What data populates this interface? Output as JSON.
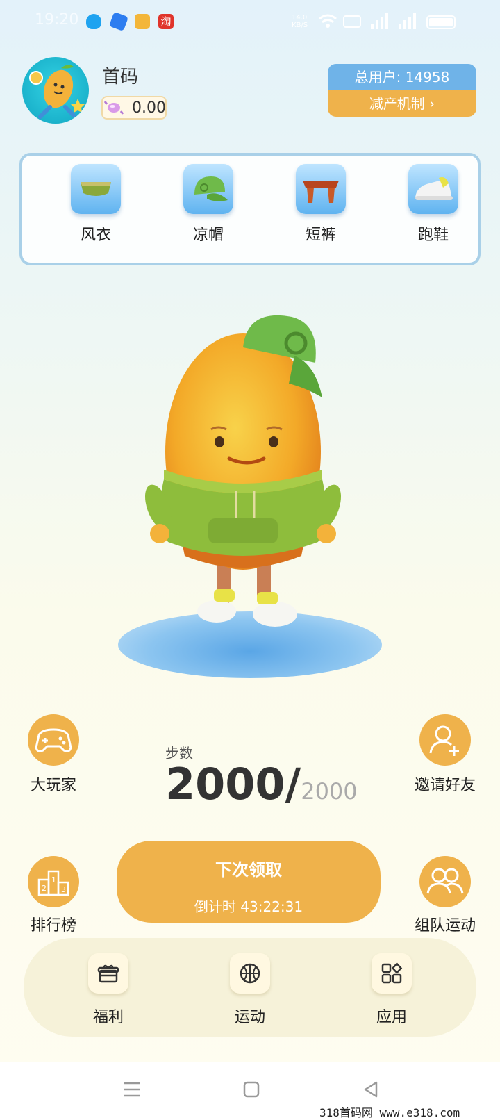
{
  "status_bar": {
    "time": "19:20",
    "speed": "14.0 KB/S"
  },
  "profile": {
    "username": "首码",
    "balance": "0.00"
  },
  "users": {
    "total": "总用户: 14958",
    "mechanism": "减产机制"
  },
  "equipment": [
    {
      "label": "风衣",
      "icon": "jacket-icon"
    },
    {
      "label": "凉帽",
      "icon": "cap-icon"
    },
    {
      "label": "短裤",
      "icon": "shorts-icon"
    },
    {
      "label": "跑鞋",
      "icon": "sneaker-icon"
    }
  ],
  "side": {
    "player": "大玩家",
    "invite": "邀请好友",
    "ranking": "排行榜",
    "team": "组队运动"
  },
  "steps": {
    "label": "步数",
    "current": "2000/",
    "max": "2000"
  },
  "claim": {
    "title": "下次领取",
    "countdown": "倒计时 43:22:31"
  },
  "bottom_nav": [
    {
      "label": "福利",
      "icon": "gift-icon"
    },
    {
      "label": "运动",
      "icon": "basketball-icon"
    },
    {
      "label": "应用",
      "icon": "apps-icon"
    }
  ],
  "watermark": "318首码网  www.e318.com"
}
